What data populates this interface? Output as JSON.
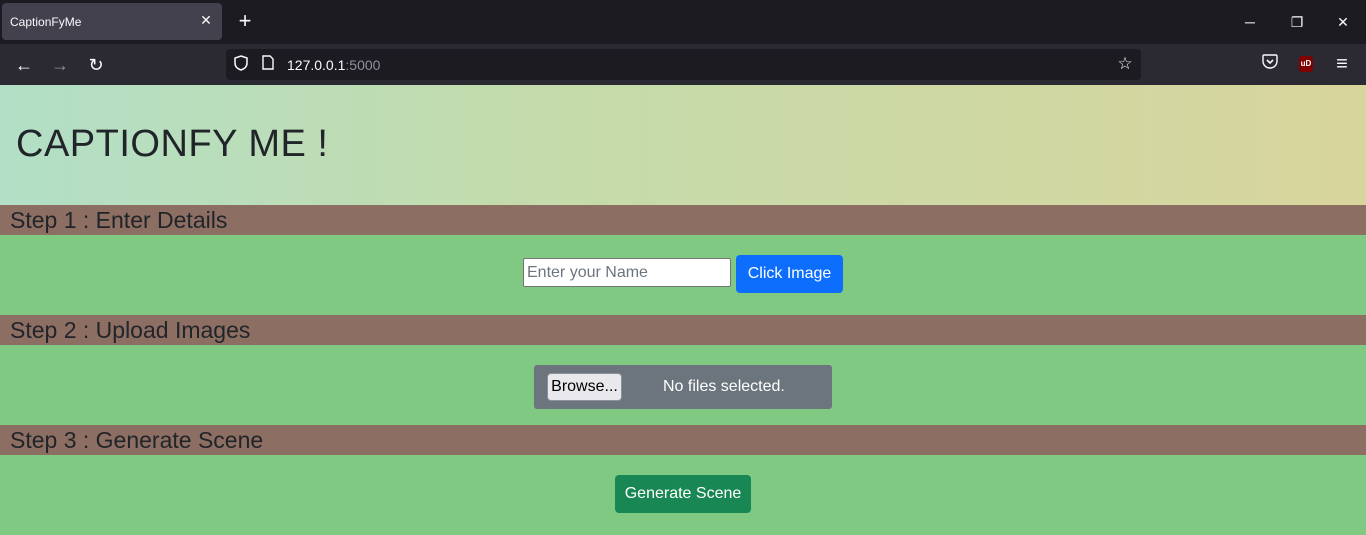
{
  "browser": {
    "tab_title": "CaptionFyMe",
    "tab_close": "✕",
    "new_tab": "+",
    "url_host": "127.0.0.1",
    "url_port": ":5000",
    "window_controls": {
      "minimize": "─",
      "restore": "❐",
      "close": "✕"
    },
    "nav": {
      "back": "←",
      "forward": "→",
      "reload": "↻"
    },
    "icons": {
      "shield": "shield-icon",
      "page": "page-icon",
      "star": "☆",
      "pocket": "pocket-icon",
      "ublock": "uD",
      "menu": "≡"
    }
  },
  "page": {
    "title": "CAPTIONFY ME !",
    "step1": {
      "heading": "Step 1 : Enter Details",
      "name_placeholder": "Enter your Name",
      "name_value": "",
      "click_image_label": "Click Image"
    },
    "step2": {
      "heading": "Step 2 : Upload Images",
      "browse_label": "Browse...",
      "file_status": "No files selected."
    },
    "step3": {
      "heading": "Step 3 : Generate Scene",
      "generate_label": "Generate Scene"
    }
  },
  "colors": {
    "page_bg": "#7fc983",
    "step_bar": "#8d6e63",
    "primary": "#0d6efd",
    "success": "#198754",
    "file_box": "#6c757d"
  }
}
